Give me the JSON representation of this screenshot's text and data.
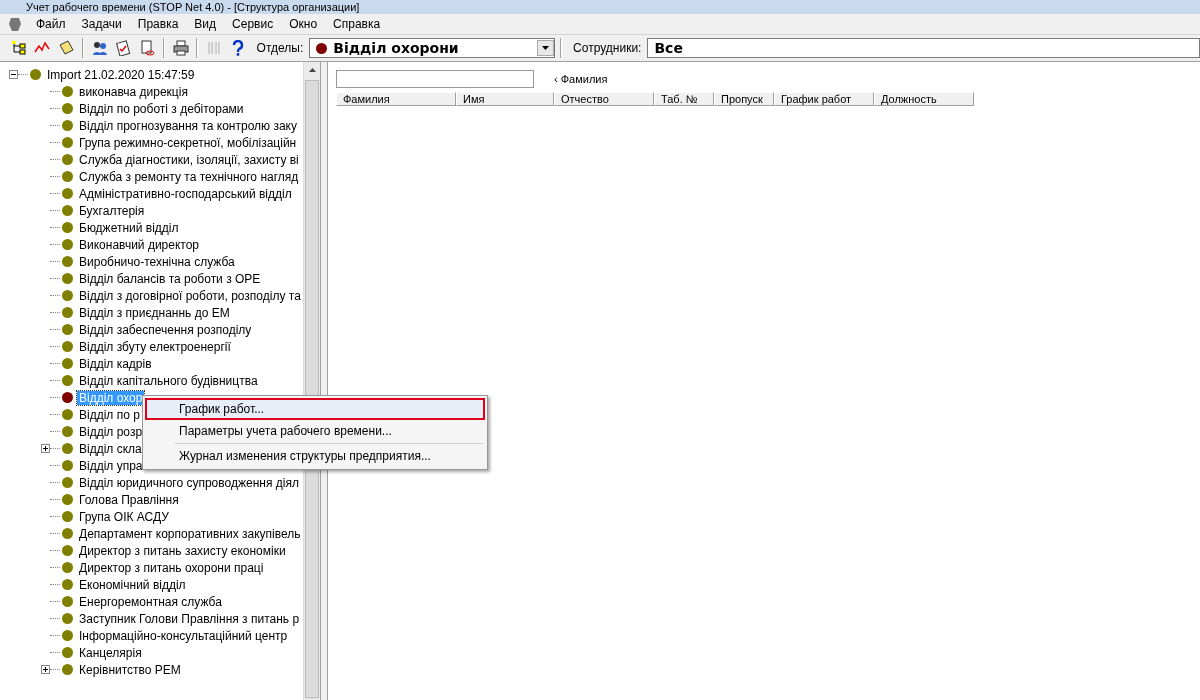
{
  "window": {
    "title": "Учет рабочего времени (STOP Net 4.0) - [Структура организации]"
  },
  "menu": [
    "Файл",
    "Задачи",
    "Правка",
    "Вид",
    "Сервис",
    "Окно",
    "Справка"
  ],
  "toolbar": {
    "icons": [
      {
        "kind": "tree",
        "disabled": false
      },
      {
        "kind": "chart",
        "disabled": false
      },
      {
        "kind": "note",
        "disabled": false
      },
      {
        "kind": "sep"
      },
      {
        "kind": "people",
        "disabled": false
      },
      {
        "kind": "check",
        "disabled": false
      },
      {
        "kind": "doc",
        "disabled": false
      },
      {
        "kind": "sep"
      },
      {
        "kind": "printer",
        "disabled": false
      },
      {
        "kind": "sep"
      },
      {
        "kind": "columns",
        "disabled": true
      },
      {
        "kind": "help",
        "disabled": false
      }
    ],
    "departments": {
      "label": "Отделы:",
      "value": "Відділ охорони",
      "color": "#800000"
    },
    "employees": {
      "label": "Сотрудники:",
      "value": "Все"
    }
  },
  "tree": {
    "root": {
      "label": "Import 21.02.2020 15:47:59",
      "expanded": true,
      "color": "#808000",
      "children": [
        {
          "label": "виконавча дирекція",
          "selected": false,
          "expandable": false,
          "color": "#808000"
        },
        {
          "label": "Відділ по роботі з дебіторами",
          "selected": false,
          "expandable": false,
          "color": "#808000"
        },
        {
          "label": "Відділ прогнозування та контролю заку",
          "selected": false,
          "expandable": false,
          "color": "#808000"
        },
        {
          "label": "Група режимно-секретної, мобілізаційн",
          "selected": false,
          "expandable": false,
          "color": "#808000"
        },
        {
          "label": "Служба діагностики, ізоляції, захисту ві",
          "selected": false,
          "expandable": false,
          "color": "#808000"
        },
        {
          "label": "Служба з ремонту та технічного нагляд",
          "selected": false,
          "expandable": false,
          "color": "#808000"
        },
        {
          "label": "Адміністративно-господарський відділ",
          "selected": false,
          "expandable": false,
          "color": "#808000"
        },
        {
          "label": "Бухгалтерія",
          "selected": false,
          "expandable": false,
          "color": "#808000"
        },
        {
          "label": "Бюджетний відділ",
          "selected": false,
          "expandable": false,
          "color": "#808000"
        },
        {
          "label": "Виконавчий директор",
          "selected": false,
          "expandable": false,
          "color": "#808000"
        },
        {
          "label": "Виробничо-технічна служба",
          "selected": false,
          "expandable": false,
          "color": "#808000"
        },
        {
          "label": "Відділ балансів та роботи з ОРЕ",
          "selected": false,
          "expandable": false,
          "color": "#808000"
        },
        {
          "label": "Відділ з договірної роботи, розподілу та",
          "selected": false,
          "expandable": false,
          "color": "#808000"
        },
        {
          "label": "Відділ з приєднаннь до ЕМ",
          "selected": false,
          "expandable": false,
          "color": "#808000"
        },
        {
          "label": "Відділ забеспечення розподілу",
          "selected": false,
          "expandable": false,
          "color": "#808000"
        },
        {
          "label": "Відділ збуту електроенергії",
          "selected": false,
          "expandable": false,
          "color": "#808000"
        },
        {
          "label": "Відділ кадрів",
          "selected": false,
          "expandable": false,
          "color": "#808000"
        },
        {
          "label": "Відділ капітального будівництва",
          "selected": false,
          "expandable": false,
          "color": "#808000"
        },
        {
          "label": "Відділ охор",
          "selected": true,
          "expandable": false,
          "color": "#800000"
        },
        {
          "label": "Відділ по р",
          "selected": false,
          "expandable": false,
          "color": "#808000"
        },
        {
          "label": "Відділ розр",
          "selected": false,
          "expandable": false,
          "color": "#808000"
        },
        {
          "label": "Відділ скла",
          "selected": false,
          "expandable": true,
          "color": "#808000"
        },
        {
          "label": "Відділ упра",
          "selected": false,
          "expandable": false,
          "color": "#808000"
        },
        {
          "label": "Відділ юридичного супроводження діял",
          "selected": false,
          "expandable": false,
          "color": "#808000"
        },
        {
          "label": "Голова Правління",
          "selected": false,
          "expandable": false,
          "color": "#808000"
        },
        {
          "label": "Група ОІК АСДУ",
          "selected": false,
          "expandable": false,
          "color": "#808000"
        },
        {
          "label": "Департамент корпоративних закупівель",
          "selected": false,
          "expandable": false,
          "color": "#808000"
        },
        {
          "label": "Директор з питань захисту економіки",
          "selected": false,
          "expandable": false,
          "color": "#808000"
        },
        {
          "label": "Директор з питань охорони праці",
          "selected": false,
          "expandable": false,
          "color": "#808000"
        },
        {
          "label": "Економічний відділ",
          "selected": false,
          "expandable": false,
          "color": "#808000"
        },
        {
          "label": "Енергоремонтная служба",
          "selected": false,
          "expandable": false,
          "color": "#808000"
        },
        {
          "label": "Заступник Голови Правління з питань р",
          "selected": false,
          "expandable": false,
          "color": "#808000"
        },
        {
          "label": "Інформаційно-консультаційний центр",
          "selected": false,
          "expandable": false,
          "color": "#808000"
        },
        {
          "label": "Канцелярія",
          "selected": false,
          "expandable": false,
          "color": "#808000"
        },
        {
          "label": "Керівнитство РЕМ",
          "selected": false,
          "expandable": true,
          "color": "#808000"
        }
      ]
    }
  },
  "context_menu": [
    {
      "kind": "item",
      "label": "График работ...",
      "selected": true
    },
    {
      "kind": "item",
      "label": "Параметры учета рабочего времени...",
      "selected": false
    },
    {
      "kind": "separator"
    },
    {
      "kind": "item",
      "label": "Журнал изменения структуры предприятия...",
      "selected": false
    }
  ],
  "search": {
    "sort_label": "‹ Фамилия"
  },
  "table": {
    "columns": [
      "Фамилия",
      "Имя",
      "Отчество",
      "Таб. №",
      "Пропуск",
      "График работ",
      "Должность"
    ]
  }
}
